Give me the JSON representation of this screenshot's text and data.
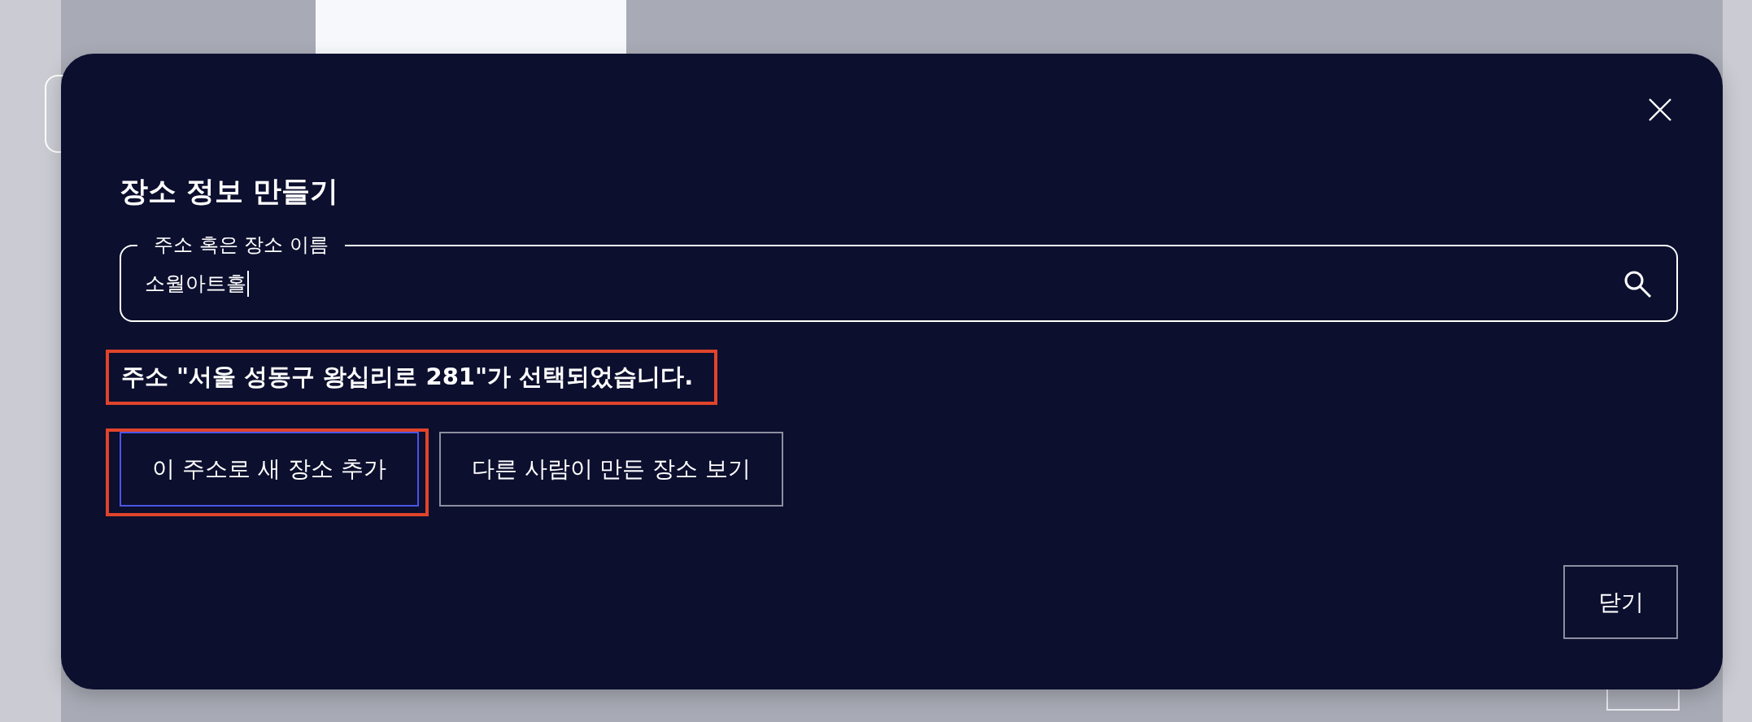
{
  "dialog": {
    "title": "장소 정보 만들기",
    "search": {
      "label": "주소 혹은 장소 이름",
      "value": "소월아트홀"
    },
    "message": {
      "text": "주소 \"서울 성동구 왕십리로 281\"가 선택되었습니다.",
      "highlighted": true
    },
    "actions": [
      {
        "label": "이 주소로 새 장소 추가",
        "focused": true,
        "highlighted": true
      },
      {
        "label": "다른 사람이 만든 장소 보기",
        "focused": false,
        "highlighted": false
      }
    ],
    "close_button": "닫기"
  }
}
